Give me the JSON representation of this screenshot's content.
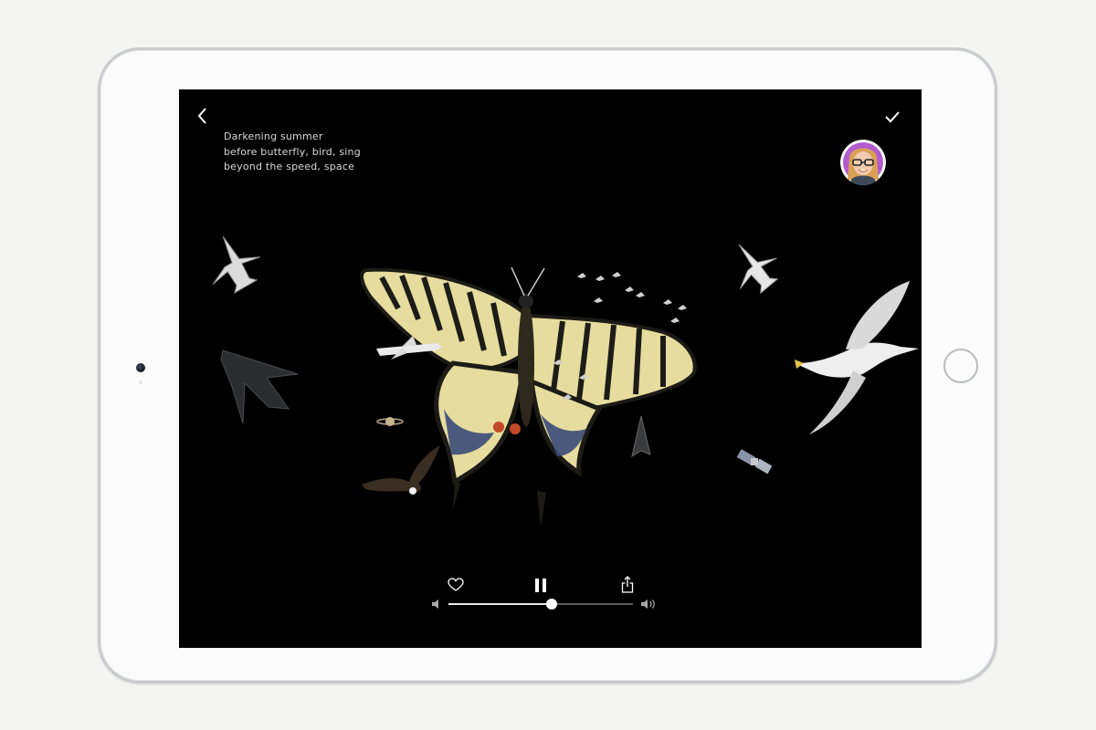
{
  "poem": {
    "lines": [
      "Darkening summer",
      "before butterfly, bird, sing",
      "beyond the speed, space"
    ]
  },
  "toolbar": {
    "back_icon": "chevron-left-icon",
    "done_icon": "checkmark-icon"
  },
  "player": {
    "like_icon": "heart-outline-icon",
    "pause_icon": "pause-icon",
    "share_icon": "share-icon",
    "volume_min_icon": "speaker-low-icon",
    "volume_max_icon": "speaker-high-icon",
    "volume_fraction": 0.56
  },
  "colors": {
    "screen": "#000000",
    "text": "#d8d8d8",
    "slider_fill": "#e8e8e8",
    "slider_track": "#5a5a5a",
    "butterfly_yellow": "#e7dd9f",
    "butterfly_black": "#1e1c17",
    "butterfly_blue": "#3a4a78",
    "butterfly_red": "#c24a2a"
  }
}
